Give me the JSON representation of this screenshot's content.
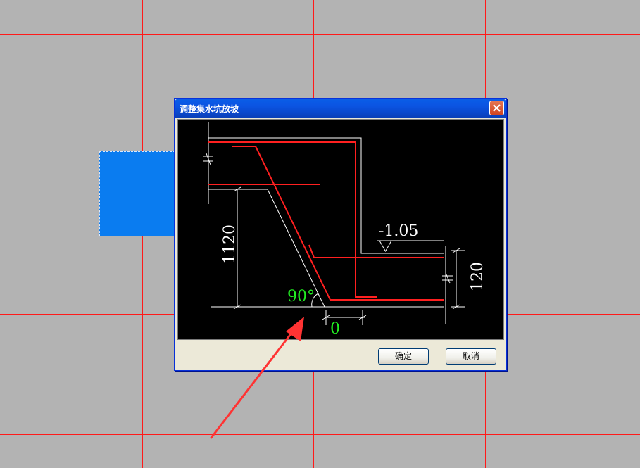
{
  "dialog": {
    "title": "调整集水坑放坡",
    "ok_label": "确定",
    "cancel_label": "取消"
  },
  "drawing": {
    "depth_label": "1120",
    "elevation_label": "-1.05",
    "thickness_label": "120",
    "angle_label": "90°",
    "offset_label": "0"
  },
  "colors": {
    "background": "#b3b3b3",
    "grid": "#ff1a1a",
    "selection": "#0a7cf0",
    "rebar": "#ff2020",
    "dimension": "#ffffff",
    "parameter": "#22ee22",
    "arrow": "#ff3333"
  },
  "icons": {
    "close": "close-icon",
    "elevation_marker": "elevation-triangle-icon",
    "annotation_arrow": "arrow-icon"
  }
}
